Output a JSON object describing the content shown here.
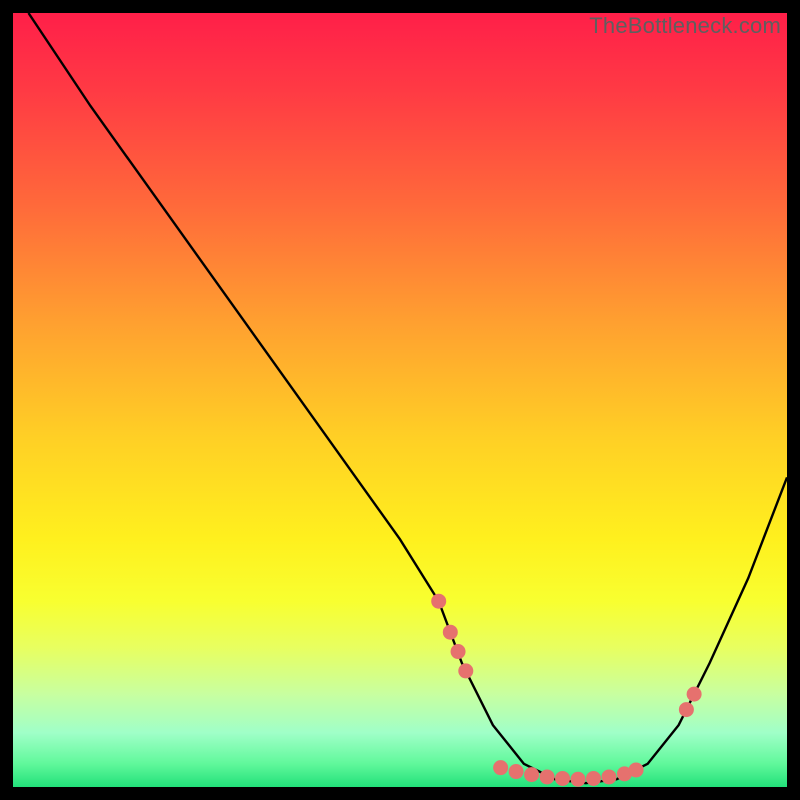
{
  "watermark": "TheBottleneck.com",
  "chart_data": {
    "type": "line",
    "title": "",
    "xlabel": "",
    "ylabel": "",
    "xlim": [
      0,
      100
    ],
    "ylim": [
      0,
      100
    ],
    "grid": false,
    "legend": false,
    "series": [
      {
        "name": "bottleneck-curve",
        "x": [
          2,
          10,
          20,
          30,
          40,
          50,
          55,
          58,
          62,
          66,
          70,
          74,
          78,
          82,
          86,
          90,
          95,
          100
        ],
        "y": [
          100,
          88,
          74,
          60,
          46,
          32,
          24,
          16,
          8,
          3,
          1,
          0.5,
          1,
          3,
          8,
          16,
          27,
          40
        ]
      }
    ],
    "markers": [
      {
        "x": 55.0,
        "y": 24.0
      },
      {
        "x": 56.5,
        "y": 20.0
      },
      {
        "x": 57.5,
        "y": 17.5
      },
      {
        "x": 58.5,
        "y": 15.0
      },
      {
        "x": 63.0,
        "y": 2.5
      },
      {
        "x": 65.0,
        "y": 2.0
      },
      {
        "x": 67.0,
        "y": 1.6
      },
      {
        "x": 69.0,
        "y": 1.3
      },
      {
        "x": 71.0,
        "y": 1.1
      },
      {
        "x": 73.0,
        "y": 1.0
      },
      {
        "x": 75.0,
        "y": 1.1
      },
      {
        "x": 77.0,
        "y": 1.3
      },
      {
        "x": 79.0,
        "y": 1.7
      },
      {
        "x": 80.5,
        "y": 2.2
      },
      {
        "x": 87.0,
        "y": 10.0
      },
      {
        "x": 88.0,
        "y": 12.0
      }
    ],
    "gradient_stops": [
      {
        "offset": 0.0,
        "color": "#ff1f49"
      },
      {
        "offset": 0.1,
        "color": "#ff3a44"
      },
      {
        "offset": 0.25,
        "color": "#ff6a3a"
      },
      {
        "offset": 0.4,
        "color": "#ffa030"
      },
      {
        "offset": 0.55,
        "color": "#ffd025"
      },
      {
        "offset": 0.68,
        "color": "#fff01e"
      },
      {
        "offset": 0.76,
        "color": "#f8ff30"
      },
      {
        "offset": 0.82,
        "color": "#e8ff60"
      },
      {
        "offset": 0.88,
        "color": "#c8ffa0"
      },
      {
        "offset": 0.93,
        "color": "#a0ffc8"
      },
      {
        "offset": 0.97,
        "color": "#60f89b"
      },
      {
        "offset": 1.0,
        "color": "#22e07a"
      }
    ],
    "marker_color": "#e6716e",
    "curve_color": "#000000"
  }
}
